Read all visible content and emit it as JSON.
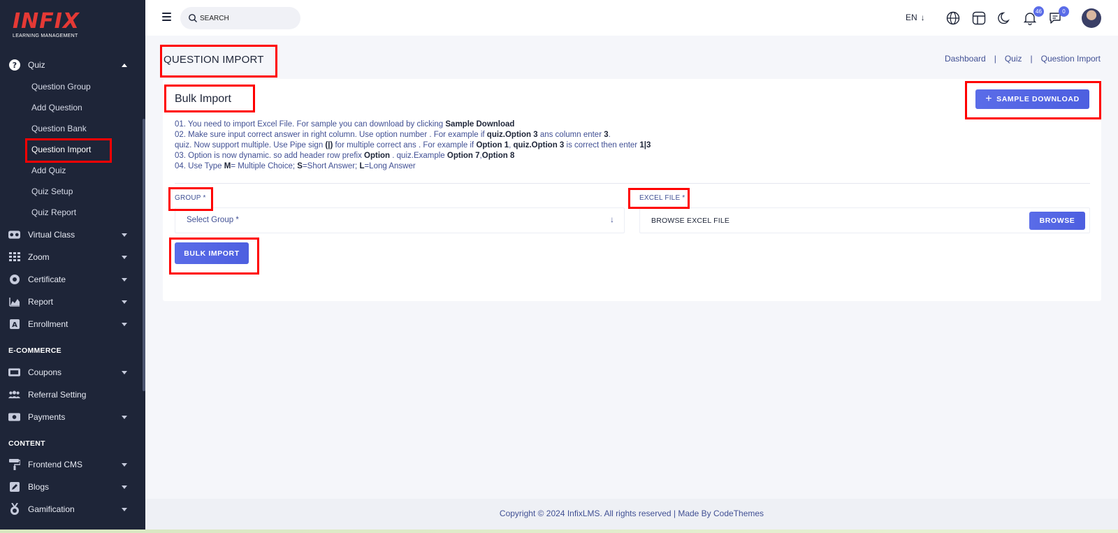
{
  "logo": {
    "word": "INFIX",
    "sub": "LEARNING MANAGEMENT"
  },
  "sidebar": {
    "quiz_label": "Quiz",
    "quiz_sub": [
      "Question Group",
      "Add Question",
      "Question Bank",
      "Question Import",
      "Add Quiz",
      "Quiz Setup",
      "Quiz Report"
    ],
    "items_a": [
      "Virtual Class",
      "Zoom",
      "Certificate",
      "Report",
      "Enrollment"
    ],
    "section_ecommerce": "E-COMMERCE",
    "items_b": [
      "Coupons",
      "Referral Setting",
      "Payments"
    ],
    "section_content": "CONTENT",
    "items_c": [
      "Frontend CMS",
      "Blogs",
      "Gamification"
    ]
  },
  "topbar": {
    "search_placeholder": "SEARCH",
    "lang": "EN",
    "notifications_count": "46",
    "messages_count": "0"
  },
  "header": {
    "title": "QUESTION IMPORT",
    "breadcrumb": [
      "Dashboard",
      "Quiz",
      "Question Import"
    ],
    "separator": "|"
  },
  "card": {
    "title": "Bulk Import",
    "sample_download": "SAMPLE DOWNLOAD",
    "instructions": {
      "l1": "01. You need to import Excel File. For sample you can download by clicking ",
      "l1_b": "Sample Download",
      "l2": "02. Make sure input correct answer in right column. Use option number . For example if ",
      "l2_b1": "quiz.Option 3",
      "l2_m": " ans column enter ",
      "l2_b2": "3",
      "l2_end": ".",
      "l3a": "quiz. Now support multiple. Use Pipe sign ",
      "l3_b1": "(|)",
      "l3b": " for multiple correct ans . For example if ",
      "l3_b2": "Option 1",
      "l3c": ", ",
      "l3_b3": "quiz.Option 3",
      "l3d": " is correct then enter ",
      "l3_b4": "1|3",
      "l4a": "03. Option is now dynamic. so add header row prefix ",
      "l4_b1": "Option",
      "l4b": " . quiz.Example ",
      "l4_b2": "Option 7",
      "l4c": ",",
      "l4_b3": "Option 8",
      "l5a": "04. Use Type ",
      "l5_b1": "M",
      "l5b": "= Multiple Choice; ",
      "l5_b2": "S",
      "l5c": "=Short Answer; ",
      "l5_b3": "L",
      "l5d": "=Long Answer"
    },
    "group_label": "GROUP *",
    "group_value": "Select Group *",
    "excel_label": "EXCEL FILE *",
    "excel_value": "BROWSE EXCEL FILE",
    "browse": "BROWSE",
    "bulk_import": "BULK IMPORT"
  },
  "footer": {
    "text": "Copyright © 2024 InfixLMS. All rights reserved | Made By CodeThemes"
  },
  "colors": {
    "accent": "#5a6ce8",
    "sidebar": "#1e2538",
    "highlight": "#ff0000",
    "brand": "#e53935"
  }
}
